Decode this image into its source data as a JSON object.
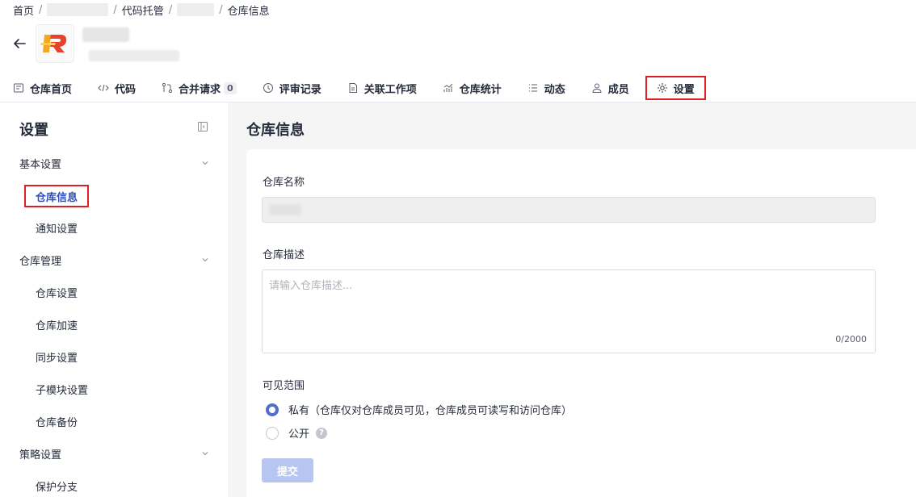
{
  "breadcrumb": {
    "home": "首页",
    "sep": "/",
    "code_hosting": "代码托管",
    "current": "仓库信息"
  },
  "tabs": [
    {
      "label": "仓库首页",
      "icon": "repo-home-icon"
    },
    {
      "label": "代码",
      "icon": "code-icon"
    },
    {
      "label": "合并请求",
      "icon": "merge-request-icon",
      "badge": "0"
    },
    {
      "label": "评审记录",
      "icon": "review-icon"
    },
    {
      "label": "关联工作项",
      "icon": "work-item-icon"
    },
    {
      "label": "仓库统计",
      "icon": "stats-icon"
    },
    {
      "label": "动态",
      "icon": "activity-icon"
    },
    {
      "label": "成员",
      "icon": "members-icon"
    },
    {
      "label": "设置",
      "icon": "gear-icon",
      "active": true
    }
  ],
  "sidebar": {
    "title": "设置",
    "groups": [
      {
        "label": "基本设置",
        "items": [
          "仓库信息",
          "通知设置"
        ]
      },
      {
        "label": "仓库管理",
        "items": [
          "仓库设置",
          "仓库加速",
          "同步设置",
          "子模块设置",
          "仓库备份"
        ]
      },
      {
        "label": "策略设置",
        "items": [
          "保护分支"
        ]
      }
    ],
    "active_item": "仓库信息"
  },
  "main": {
    "title": "仓库信息",
    "repo_name_label": "仓库名称",
    "repo_desc_label": "仓库描述",
    "repo_desc_placeholder": "请输入仓库描述...",
    "char_count": "0/2000",
    "visibility_label": "可见范围",
    "visibility_options": [
      {
        "label": "私有（仓库仅对仓库成员可见，仓库成员可读写和访问仓库）",
        "checked": true
      },
      {
        "label": "公开",
        "checked": false
      }
    ],
    "submit_label": "提交"
  },
  "colors": {
    "accent": "#526ecc",
    "highlight_border": "#e02020",
    "disabled_button": "#b7c5f0"
  }
}
